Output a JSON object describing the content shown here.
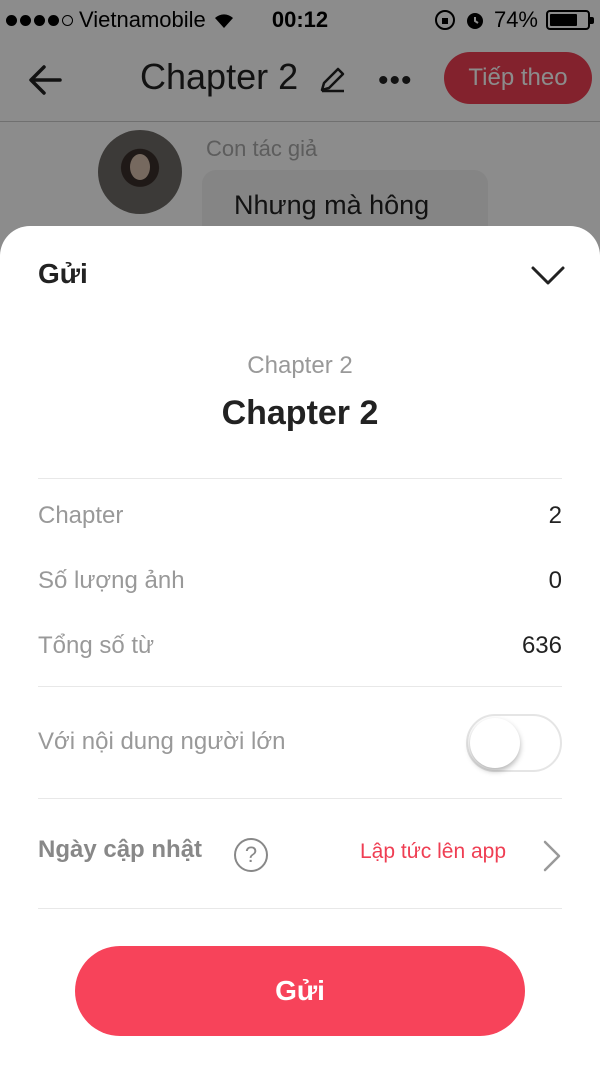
{
  "status_bar": {
    "carrier": "Vietnamobile",
    "time": "00:12",
    "battery": "74%",
    "battery_level": 0.74
  },
  "nav": {
    "title": "Chapter 2",
    "more": "•••",
    "next_button": "Tiếp theo"
  },
  "chat": {
    "author": "Con tác giả",
    "message": "Nhưng mà hông"
  },
  "sheet": {
    "title": "Gửi",
    "chapter_subtitle": "Chapter 2",
    "chapter_title": "Chapter 2",
    "stats": [
      {
        "label": "Chapter",
        "value": "2"
      },
      {
        "label": "Số lượng ảnh",
        "value": "0"
      },
      {
        "label": "Tổng số từ",
        "value": "636"
      }
    ],
    "adult_content": {
      "label": "Với nội dung người lớn",
      "enabled": false
    },
    "update_date": {
      "label": "Ngày cập nhật",
      "help": "?",
      "value": "Lập tức lên app"
    },
    "submit_button": "Gửi"
  },
  "colors": {
    "accent": "#ef3e53",
    "submit": "#f7435a"
  }
}
